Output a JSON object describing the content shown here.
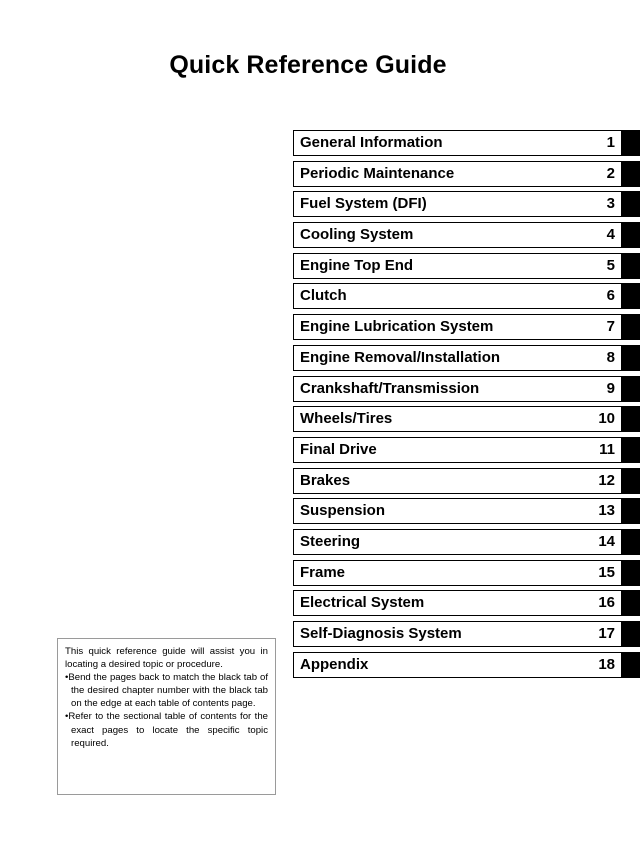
{
  "document": {
    "title": "Quick Reference Guide"
  },
  "chapters": [
    {
      "name": "General Information",
      "number": "1"
    },
    {
      "name": "Periodic Maintenance",
      "number": "2"
    },
    {
      "name": "Fuel System (DFI)",
      "number": "3"
    },
    {
      "name": "Cooling System",
      "number": "4"
    },
    {
      "name": "Engine Top End",
      "number": "5"
    },
    {
      "name": "Clutch",
      "number": "6"
    },
    {
      "name": "Engine Lubrication System",
      "number": "7"
    },
    {
      "name": "Engine Removal/Installation",
      "number": "8"
    },
    {
      "name": "Crankshaft/Transmission",
      "number": "9"
    },
    {
      "name": "Wheels/Tires",
      "number": "10"
    },
    {
      "name": "Final Drive",
      "number": "11"
    },
    {
      "name": "Brakes",
      "number": "12"
    },
    {
      "name": "Suspension",
      "number": "13"
    },
    {
      "name": "Steering",
      "number": "14"
    },
    {
      "name": "Frame",
      "number": "15"
    },
    {
      "name": "Electrical System",
      "number": "16"
    },
    {
      "name": "Self-Diagnosis System",
      "number": "17"
    },
    {
      "name": "Appendix",
      "number": "18"
    }
  ],
  "note": {
    "intro": "This quick reference guide will assist you in locating a desired topic or procedure.",
    "bullet_mark": "•",
    "bullets": [
      "Bend the pages back to match the black tab of the desired chapter number with the black tab on the edge at each table of contents page.",
      "Refer to the sectional table of contents for the exact pages to locate the specific topic required."
    ]
  },
  "colors": {
    "tab": "#000000",
    "text": "#000000",
    "note_border": "#9a9a9a",
    "page_background": "#ffffff"
  }
}
